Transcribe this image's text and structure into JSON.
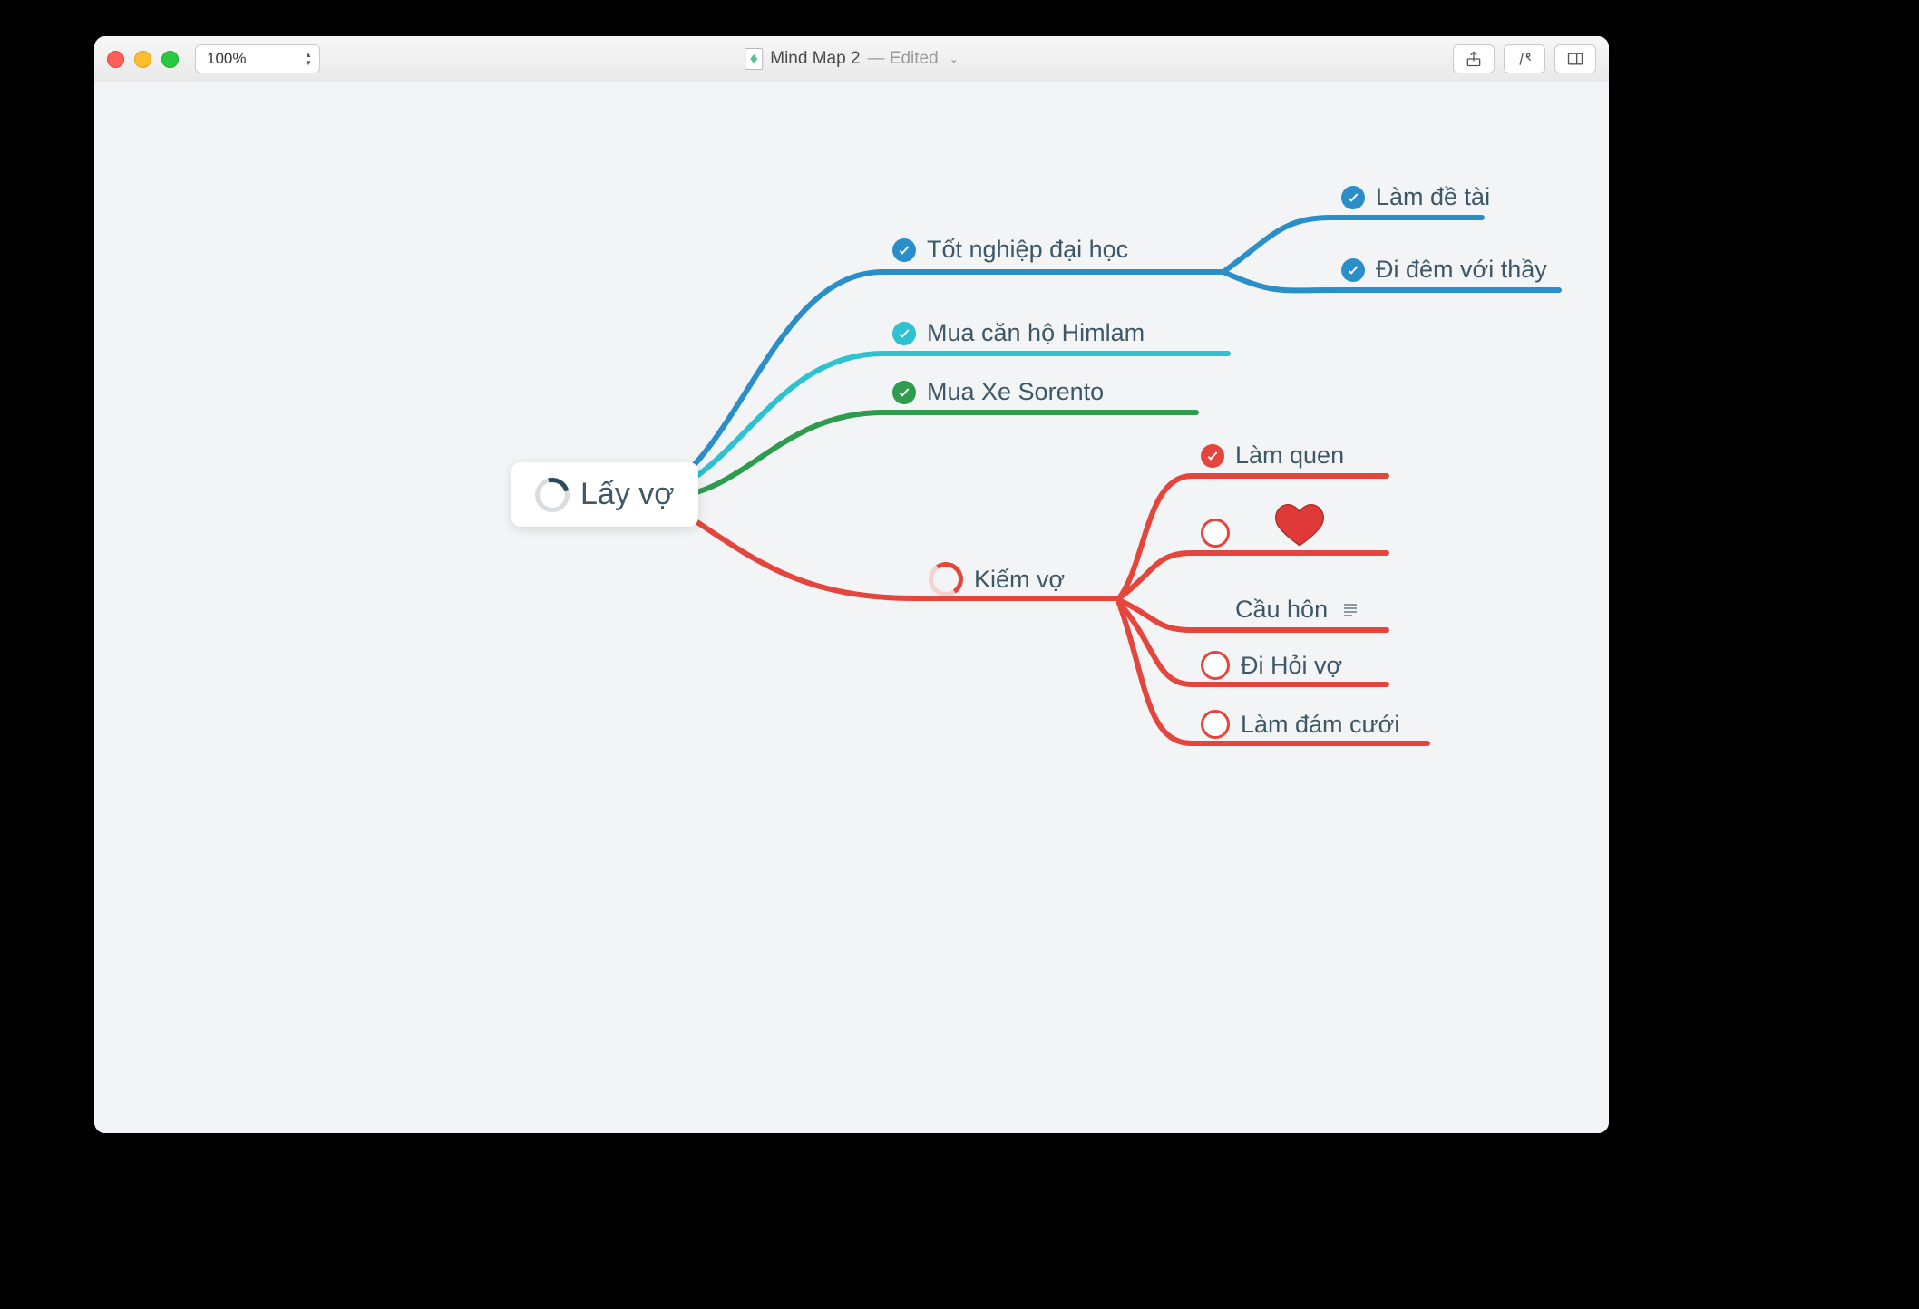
{
  "window": {
    "zoom": "100%",
    "doc_title": "Mind Map 2",
    "doc_status": "Edited"
  },
  "colors": {
    "blue": "#2a8ec9",
    "teal": "#2fc1cf",
    "green": "#2e9b4f",
    "red": "#e4453c",
    "text": "#3d5866",
    "heart": "#df3a37"
  },
  "mindmap": {
    "root": {
      "label": "Lấy vợ",
      "status": "progress"
    },
    "branches": [
      {
        "label": "Tốt nghiệp đại học",
        "color": "blue",
        "status": "done",
        "children": [
          {
            "label": "Làm đề tài",
            "status": "done"
          },
          {
            "label": "Đi đêm với thầy",
            "status": "done"
          }
        ]
      },
      {
        "label": "Mua căn hộ Himlam",
        "color": "teal",
        "status": "done"
      },
      {
        "label": "Mua Xe Sorento",
        "color": "green",
        "status": "done"
      },
      {
        "label": "Kiếm vợ",
        "color": "red",
        "status": "progress",
        "children": [
          {
            "label": "Làm quen",
            "status": "done"
          },
          {
            "label": "",
            "status": "todo",
            "icon": "heart"
          },
          {
            "label": "Cầu hôn",
            "status": "none",
            "has_note": true
          },
          {
            "label": "Đi Hỏi vợ",
            "status": "todo"
          },
          {
            "label": "Làm đám cưới",
            "status": "todo"
          }
        ]
      }
    ]
  }
}
